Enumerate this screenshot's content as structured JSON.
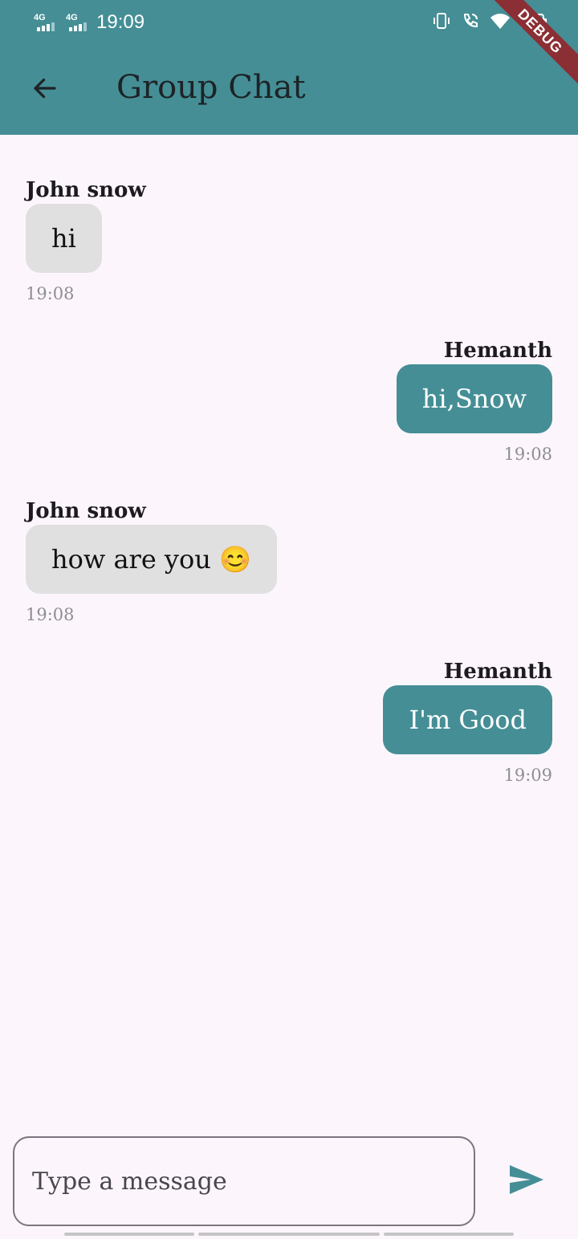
{
  "status_bar": {
    "network_1": "4G",
    "network_2": "4G",
    "time": "19:09",
    "icons": [
      "vibrate-icon",
      "wifi-call-icon",
      "wifi-icon",
      "battery-icon"
    ]
  },
  "debug_banner": "DEBUG",
  "app_bar": {
    "title": "Group Chat",
    "back_icon": "arrow-left-icon"
  },
  "colors": {
    "primary": "#458e96",
    "incoming_bubble": "#e0e0e0",
    "background": "#fcf6fc",
    "debug": "#8b2f35"
  },
  "messages": [
    {
      "sender": "John snow",
      "text": "hi",
      "time": "19:08",
      "side": "left"
    },
    {
      "sender": "Hemanth",
      "text": "hi,Snow",
      "time": "19:08",
      "side": "right"
    },
    {
      "sender": "John snow",
      "text": "how are you 😊",
      "time": "19:08",
      "side": "left"
    },
    {
      "sender": "Hemanth",
      "text": "I'm Good",
      "time": "19:09",
      "side": "right"
    }
  ],
  "composer": {
    "placeholder": "Type a message",
    "value": "",
    "send_icon": "send-icon"
  }
}
